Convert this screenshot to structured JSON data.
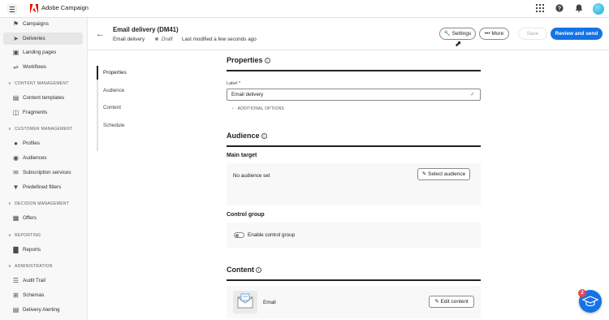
{
  "topbar": {
    "app_name": "Adobe Campaign",
    "icons": [
      "menu-icon",
      "adobe-logo",
      "apps-grid-icon",
      "help-icon",
      "notifications-icon",
      "avatar"
    ]
  },
  "sidebar": {
    "items": [
      {
        "label": "Campaigns",
        "icon": "campaigns-icon"
      },
      {
        "label": "Deliveries",
        "icon": "deliveries-icon",
        "active": true
      },
      {
        "label": "Landing pages",
        "icon": "landing-pages-icon"
      },
      {
        "label": "Workflows",
        "icon": "workflows-icon"
      }
    ],
    "sections": [
      {
        "title": "CONTENT MANAGEMENT",
        "items": [
          {
            "label": "Content templates",
            "icon": "content-templates-icon"
          },
          {
            "label": "Fragments",
            "icon": "fragments-icon"
          }
        ]
      },
      {
        "title": "CUSTOMER MANAGEMENT",
        "items": [
          {
            "label": "Profiles",
            "icon": "profiles-icon"
          },
          {
            "label": "Audiences",
            "icon": "audiences-icon"
          },
          {
            "label": "Subscription services",
            "icon": "subscription-services-icon"
          },
          {
            "label": "Predefined filters",
            "icon": "predefined-filters-icon"
          }
        ]
      },
      {
        "title": "DECISION MANAGEMENT",
        "items": [
          {
            "label": "Offers",
            "icon": "offers-icon"
          }
        ]
      },
      {
        "title": "REPORTING",
        "items": [
          {
            "label": "Reports",
            "icon": "reports-icon"
          }
        ]
      },
      {
        "title": "ADMINISTRATION",
        "items": [
          {
            "label": "Audit Trail",
            "icon": "audit-trail-icon"
          },
          {
            "label": "Schemas",
            "icon": "schemas-icon"
          },
          {
            "label": "Delivery Alerting",
            "icon": "delivery-alerting-icon"
          }
        ]
      }
    ]
  },
  "header": {
    "title": "Email delivery (DM41)",
    "type": "Email delivery",
    "status": "Draft",
    "last_modified": "Last modified a few seconds ago",
    "buttons": {
      "settings": "Settings",
      "more": "More",
      "save": "Save",
      "review": "Review and send"
    }
  },
  "steps": [
    "Properties",
    "Audience",
    "Content",
    "Schedule"
  ],
  "properties": {
    "title": "Properties",
    "label_caption": "Label",
    "label_required": "*",
    "label_value": "Email delivery",
    "additional_options": "ADDITIONAL OPTIONS"
  },
  "audience": {
    "title": "Audience",
    "main_target": "Main target",
    "no_audience": "No audience set",
    "select_button": "Select audience",
    "control_group": "Control group",
    "enable_control_group": "Enable control group",
    "control_group_enabled": false
  },
  "content": {
    "title": "Content",
    "channel": "Email",
    "edit_button": "Edit content"
  },
  "help": {
    "badge_count": "2"
  },
  "colors": {
    "primary": "#1473e6",
    "badge": "#e34850",
    "success": "#2d9d78"
  }
}
